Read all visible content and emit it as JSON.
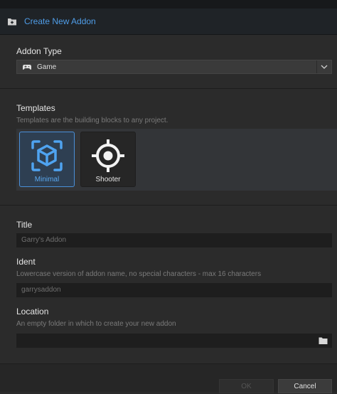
{
  "window": {
    "title": "Create New Addon",
    "title_icon": "add-folder-icon"
  },
  "addon_type": {
    "label": "Addon Type",
    "selected": "Game",
    "icon": "gamepad-icon"
  },
  "templates": {
    "label": "Templates",
    "hint": "Templates are the building blocks to any project.",
    "items": [
      {
        "label": "Minimal",
        "icon": "cube-focus-icon",
        "selected": true
      },
      {
        "label": "Shooter",
        "icon": "crosshair-icon",
        "selected": false
      }
    ]
  },
  "title_field": {
    "label": "Title",
    "placeholder": "Garry's Addon"
  },
  "ident_field": {
    "label": "Ident",
    "hint": "Lowercase version of addon name, no special characters - max 16 characters",
    "placeholder": "garrysaddon"
  },
  "location_field": {
    "label": "Location",
    "hint": "An empty folder in which to create your new addon",
    "value": ""
  },
  "buttons": {
    "ok": "OK",
    "cancel": "Cancel"
  },
  "colors": {
    "accent": "#4f9de8",
    "selected_border": "#4a90d9",
    "background": "#2a2a2a"
  }
}
